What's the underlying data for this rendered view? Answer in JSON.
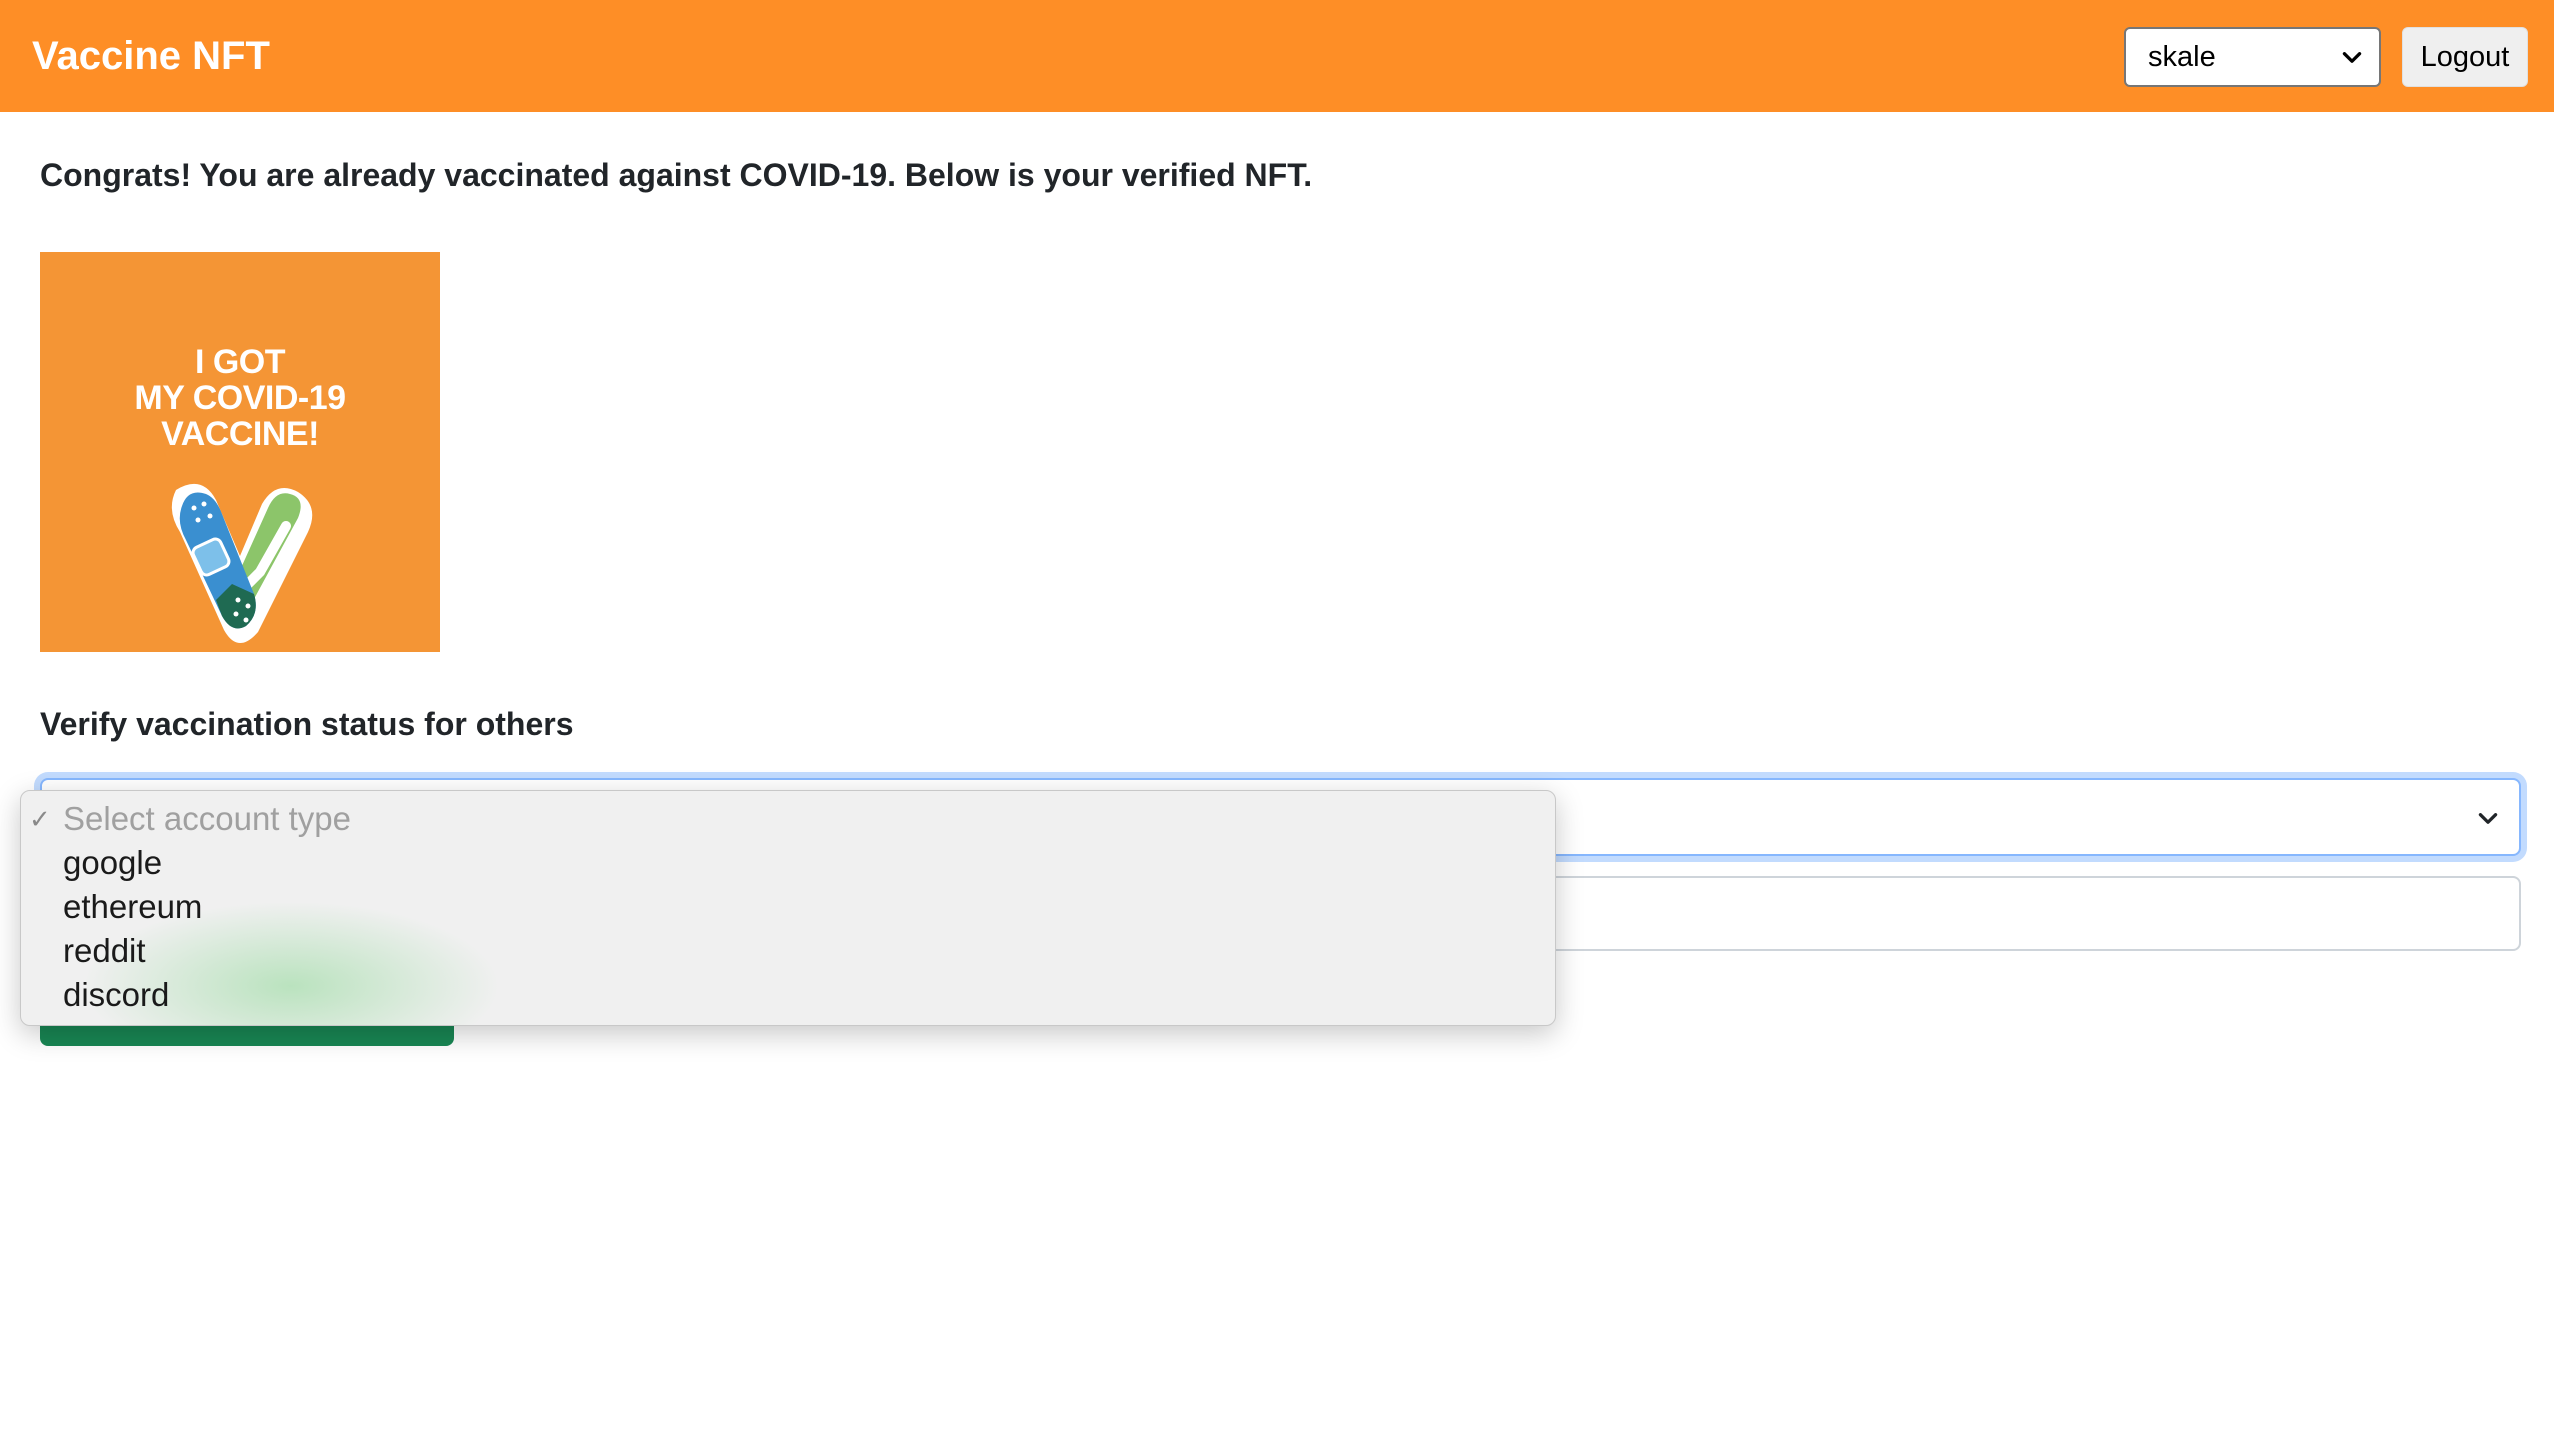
{
  "app": {
    "title": "Vaccine NFT",
    "brand_color": "#fe8e26"
  },
  "header": {
    "network_select_value": "skale",
    "logout_label": "Logout"
  },
  "main": {
    "congrats_text": "Congrats! You are already vaccinated against COVID-19. Below is your verified NFT.",
    "nft": {
      "line1": "I GOT",
      "line2": "MY COVID-19",
      "line3": "VACCINE!",
      "background_color": "#f49535"
    },
    "verify_heading": "Verify vaccination status for others",
    "account_type_dropdown": {
      "placeholder": "Select account type",
      "options": [
        "google",
        "ethereum",
        "reddit",
        "discord"
      ]
    },
    "verify_button_color": "#198754"
  }
}
